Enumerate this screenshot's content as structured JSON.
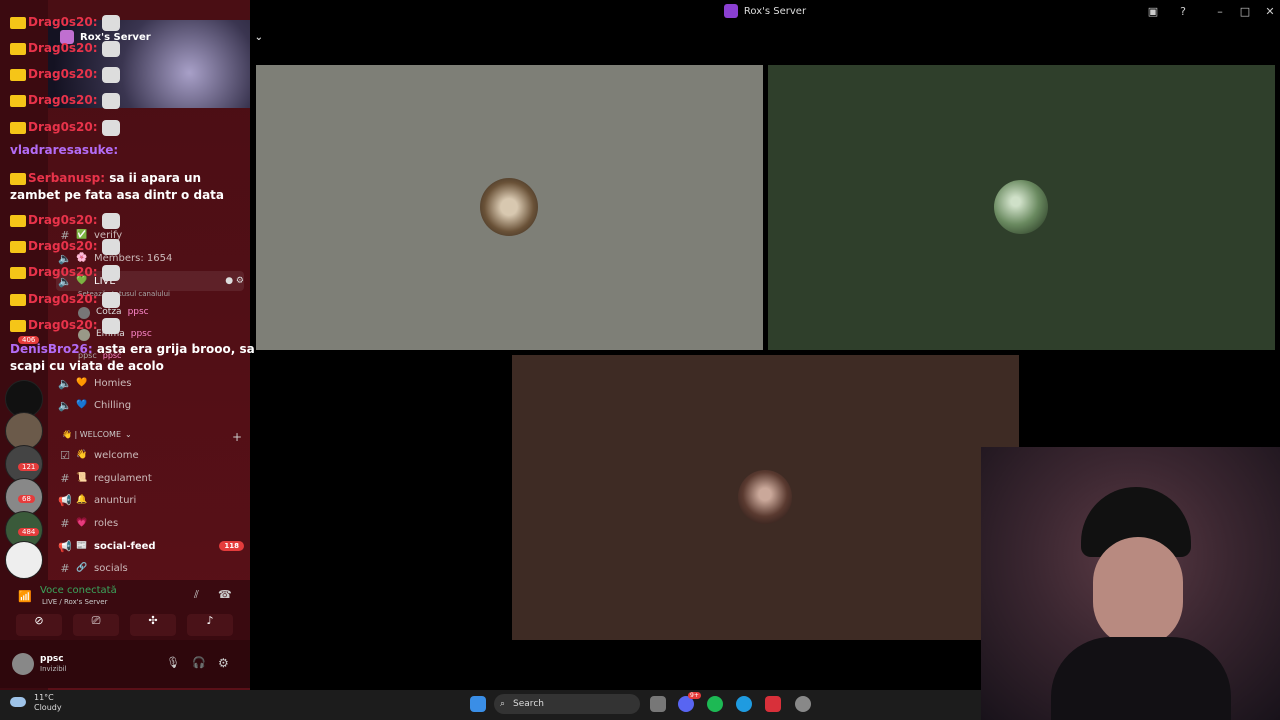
{
  "window": {
    "title": "Rox's Server"
  },
  "server": {
    "name": "Rox's Server"
  },
  "rail_badges": [
    "406",
    "121",
    "68",
    "484"
  ],
  "channels": [
    {
      "name": "verify",
      "emoji": "✅",
      "kind": "text"
    },
    {
      "name": "Members: 1654",
      "emoji": "🌸",
      "kind": "voice"
    },
    {
      "name": "LIVE",
      "emoji": "💚",
      "kind": "voice"
    },
    {
      "name": "Homies",
      "emoji": "🧡",
      "kind": "voice"
    },
    {
      "name": "Chilling",
      "emoji": "💙",
      "kind": "voice"
    }
  ],
  "live_status": "Setează statusul canalului",
  "voice_members": [
    {
      "name": "Cotza",
      "tag": "ppsc"
    },
    {
      "name": "Emma",
      "tag": "ppsc"
    },
    {
      "name": "ppsc",
      "tag": "ppsc"
    }
  ],
  "welcome_category": "👋 | WELCOME",
  "welcome_channels": [
    {
      "name": "welcome",
      "emoji": "👋",
      "count": ""
    },
    {
      "name": "regulament",
      "emoji": "📜",
      "count": ""
    },
    {
      "name": "anunturi",
      "emoji": "🔔",
      "count": ""
    },
    {
      "name": "roles",
      "emoji": "💗",
      "count": ""
    },
    {
      "name": "social-feed",
      "emoji": "📰",
      "count": "118"
    },
    {
      "name": "socials",
      "emoji": "🔗",
      "count": ""
    }
  ],
  "voice_panel": {
    "status": "Voce conectată",
    "location": "LIVE / Rox's Server"
  },
  "user": {
    "name": "ppsc",
    "status": "Invizibil"
  },
  "chat": [
    {
      "user": "Drag0s20:",
      "text": ""
    },
    {
      "user": "Drag0s20:",
      "text": ""
    },
    {
      "user": "Drag0s20:",
      "text": ""
    },
    {
      "user": "Drag0s20:",
      "text": ""
    },
    {
      "user": "Drag0s20:",
      "text": ""
    },
    {
      "user": "vladraresasuke:",
      "text": ""
    },
    {
      "user": "Serbanusp:",
      "text": "sa ii apara un"
    },
    {
      "user": "",
      "text": "zambet pe fata asa dintr o data"
    },
    {
      "user": "Drag0s20:",
      "text": ""
    },
    {
      "user": "Drag0s20:",
      "text": ""
    },
    {
      "user": "Drag0s20:",
      "text": ""
    },
    {
      "user": "Drag0s20:",
      "text": ""
    },
    {
      "user": "Drag0s20:",
      "text": ""
    },
    {
      "user": "DenisBro26:",
      "text": "asta era grija brooo, sa"
    },
    {
      "user": "",
      "text": "scapi cu viata de acolo"
    }
  ],
  "taskbar": {
    "temp": "11°C",
    "weather": "Cloudy",
    "search": "Search",
    "discord_badge": "9+"
  },
  "colors": {
    "tile1": "#7e7f77",
    "tile2": "#2f3f2b",
    "tile3": "#3e2b24",
    "accent_red": "#e8334a"
  }
}
